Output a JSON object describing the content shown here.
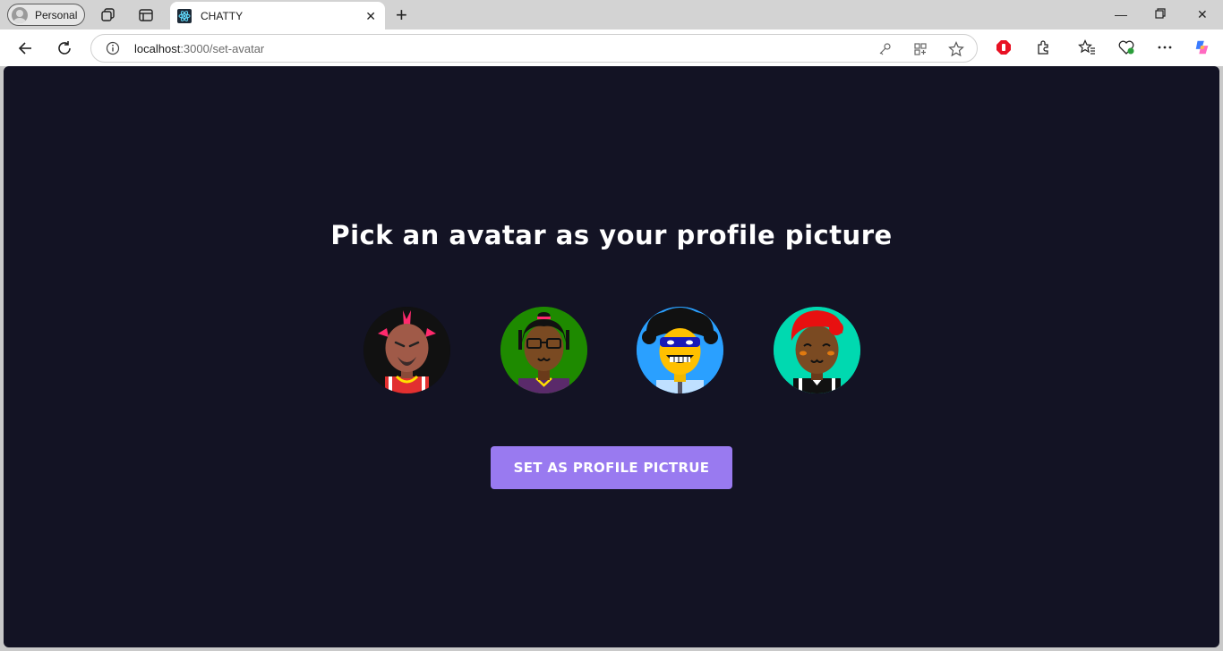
{
  "browser": {
    "profile_label": "Personal",
    "tab_title": "CHATTY",
    "url_host": "localhost",
    "url_path": ":3000/set-avatar"
  },
  "page": {
    "title": "Pick an avatar as your profile picture",
    "button_label": "SET AS PROFILE PICTRUE",
    "background_color": "#131324",
    "button_color": "#997af0"
  },
  "avatars": [
    {
      "name": "avatar-mohawk",
      "bg": "#111111"
    },
    {
      "name": "avatar-glasses",
      "bg": "#1e8a00"
    },
    {
      "name": "avatar-masked",
      "bg": "#2aa0ff"
    },
    {
      "name": "avatar-red-hat",
      "bg": "#00d9b0"
    }
  ]
}
